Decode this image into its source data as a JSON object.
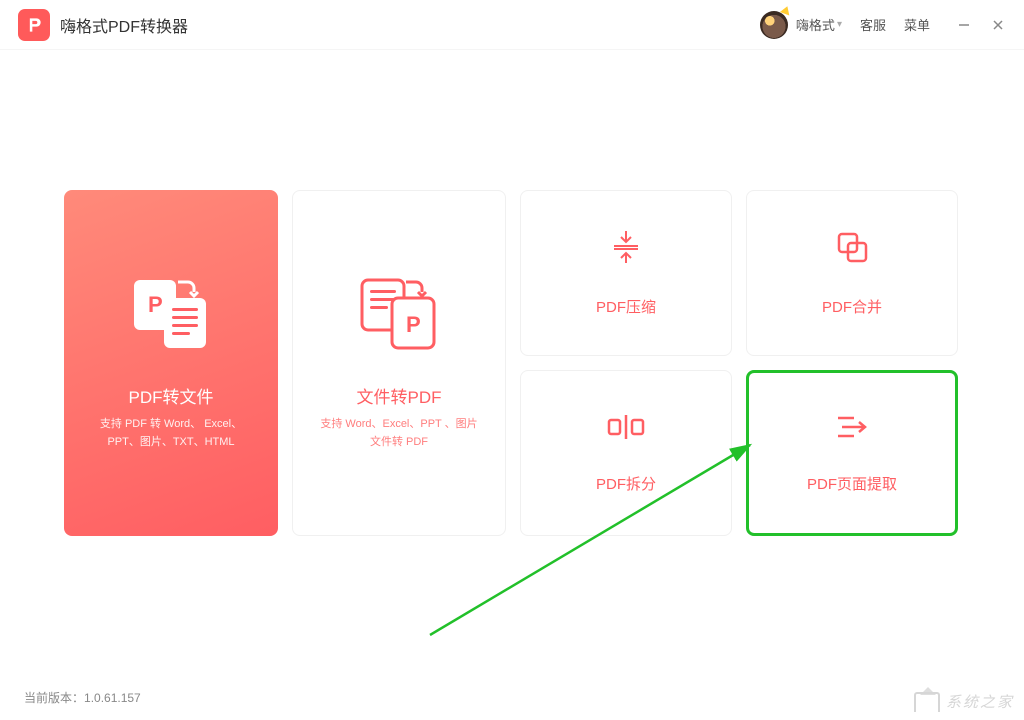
{
  "app": {
    "title": "嗨格式PDF转换器"
  },
  "header": {
    "username": "嗨格式",
    "support": "客服",
    "menu": "菜单"
  },
  "cards": {
    "pdf_to_file": {
      "title": "PDF转文件",
      "subtitle": "支持 PDF 转 Word、 Excel、PPT、图片、TXT、HTML"
    },
    "file_to_pdf": {
      "title": "文件转PDF",
      "subtitle": "支持 Word、Excel、PPT 、图片文件转 PDF"
    },
    "compress": {
      "title": "PDF压缩"
    },
    "merge": {
      "title": "PDF合并"
    },
    "split": {
      "title": "PDF拆分"
    },
    "extract": {
      "title": "PDF页面提取"
    }
  },
  "footer": {
    "version_label": "当前版本：",
    "version": "1.0.61.157"
  },
  "watermark": "系统之家"
}
